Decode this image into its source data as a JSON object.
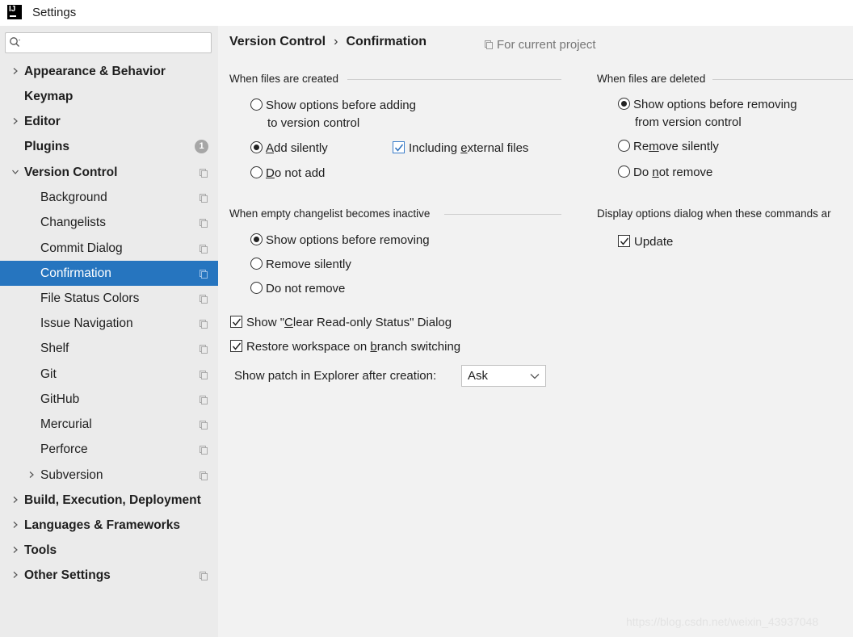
{
  "window": {
    "title": "Settings",
    "logo_text": "IJ"
  },
  "search": {
    "placeholder": "",
    "value": ""
  },
  "sidebar": {
    "items": [
      {
        "label": "Appearance & Behavior"
      },
      {
        "label": "Keymap"
      },
      {
        "label": "Editor"
      },
      {
        "label": "Plugins",
        "badge": "1"
      },
      {
        "label": "Version Control"
      },
      {
        "label": "Background"
      },
      {
        "label": "Changelists"
      },
      {
        "label": "Commit Dialog"
      },
      {
        "label": "Confirmation"
      },
      {
        "label": "File Status Colors"
      },
      {
        "label": "Issue Navigation"
      },
      {
        "label": "Shelf"
      },
      {
        "label": "Git"
      },
      {
        "label": "GitHub"
      },
      {
        "label": "Mercurial"
      },
      {
        "label": "Perforce"
      },
      {
        "label": "Subversion"
      },
      {
        "label": "Build, Execution, Deployment"
      },
      {
        "label": "Languages & Frameworks"
      },
      {
        "label": "Tools"
      },
      {
        "label": "Other Settings"
      }
    ],
    "selected_label": "Confirmation",
    "selected_color": "#2675bf"
  },
  "breadcrumb": {
    "parent": "Version Control",
    "separator": "›",
    "current": "Confirmation"
  },
  "scope": {
    "label": "For current project"
  },
  "sections": {
    "files_created": {
      "title": "When files are created",
      "opt_show_1": "Show options before adding",
      "opt_show_2": "to version control",
      "opt_add_silently_pre": "",
      "opt_add_silently_u": "A",
      "opt_add_silently_post": "dd silently",
      "opt_include_pre": "Including ",
      "opt_include_u": "e",
      "opt_include_post": "xternal files",
      "opt_not_add_u": "D",
      "opt_not_add_post": "o not add",
      "selected": "Add silently",
      "including_external_checked": true
    },
    "files_deleted": {
      "title": "When files are deleted",
      "opt_show_1": "Show options before removing",
      "opt_show_2": "from version control",
      "opt_remove_pre": "Re",
      "opt_remove_u": "m",
      "opt_remove_post": "ove silently",
      "opt_not_remove_pre": "Do ",
      "opt_not_remove_u": "n",
      "opt_not_remove_post": "ot remove",
      "selected": "Show options before removing"
    },
    "empty_changelist": {
      "title": "When empty changelist becomes inactive",
      "opt_show": "Show options before removing",
      "opt_remove": "Remove silently",
      "opt_not_remove": "Do not remove",
      "selected": "Show options before removing"
    },
    "display_dialog": {
      "title": "Display options dialog when these commands ar",
      "opt_update": "Update",
      "update_checked": true
    }
  },
  "checks": {
    "clear_readonly_pre": "Show \"",
    "clear_readonly_u": "C",
    "clear_readonly_post": "lear Read-only Status\" Dialog",
    "clear_readonly_checked": true,
    "restore_pre": "Restore workspace on ",
    "restore_u": "b",
    "restore_post": "ranch switching",
    "restore_checked": true
  },
  "patch": {
    "label": "Show patch in Explorer after creation:",
    "value": "Ask"
  },
  "watermark": "https://blog.csdn.net/weixin_43937048"
}
